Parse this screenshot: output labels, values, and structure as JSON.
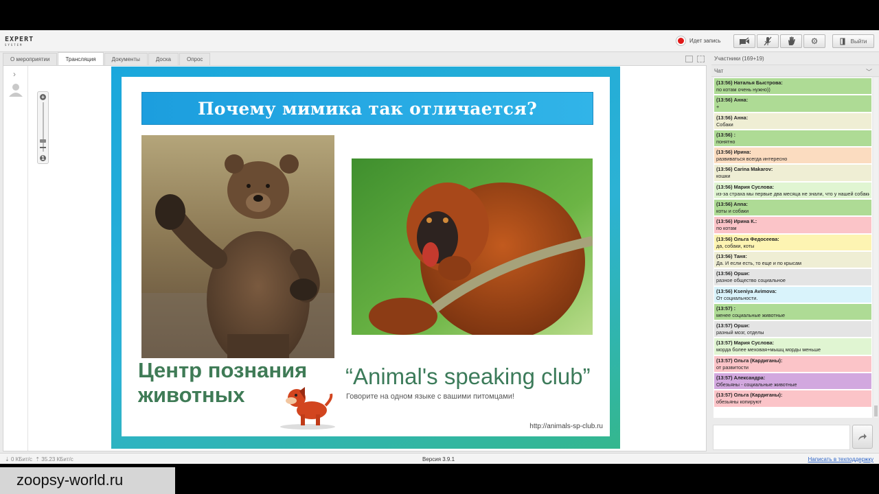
{
  "app": {
    "logo": "EXPERT",
    "logo_sub": "SYSTEM"
  },
  "recording": {
    "label": "Идет запись",
    "color": "#e01818"
  },
  "toolbar": {
    "exit_label": "Выйти"
  },
  "tabs": [
    "О мероприятии",
    "Трансляция",
    "Документы",
    "Доска",
    "Опрос"
  ],
  "active_tab": 1,
  "slide": {
    "title": "Почему мимика так отличается?",
    "center_name_line1": "Центр познания",
    "center_name_line2": "животных",
    "club_name": "“Animal's speaking club”",
    "club_subtitle": "Говорите на одном языке с вашими питомцами!",
    "club_url": "http://animals-sp-club.ru"
  },
  "participants": {
    "label": "Участники (169+19)"
  },
  "chat": {
    "header": "Чат",
    "messages": [
      {
        "time": "(13:56)",
        "author": "Наталья Быстрова:",
        "text": "по котам очень нужно))",
        "color": "#aedb95"
      },
      {
        "time": "(13:56)",
        "author": "Анна:",
        "text": "+",
        "color": "#aedb95"
      },
      {
        "time": "(13:56)",
        "author": "Анна:",
        "text": "Собаки",
        "color": "#efeed4"
      },
      {
        "time": "(13:56)",
        "author": ":",
        "text": "понятно",
        "color": "#aedb95"
      },
      {
        "time": "(13:56)",
        "author": "Ирина:",
        "text": "развиваться всегда интересно",
        "color": "#fbdcc0"
      },
      {
        "time": "(13:56)",
        "author": "Carina Makarov:",
        "text": "кошки",
        "color": "#efeed4"
      },
      {
        "time": "(13:56)",
        "author": "Мария Суслова:",
        "text": "из-за страха мы первые два месяца не знали, что у нашей собаки есть хвост",
        "color": "#e0f5d2"
      },
      {
        "time": "(13:56)",
        "author": "Anna:",
        "text": "коты и собаки",
        "color": "#aedb95"
      },
      {
        "time": "(13:56)",
        "author": "Ирина К.:",
        "text": "по котам",
        "color": "#fbc4c8"
      },
      {
        "time": "(13:56)",
        "author": "Ольга Федосеева:",
        "text": "да, собаки, коты",
        "color": "#fdf4b2"
      },
      {
        "time": "(13:56)",
        "author": "Таня:",
        "text": "Да. И если есть, то еще и по крысам",
        "color": "#efeed4"
      },
      {
        "time": "(13:56)",
        "author": "Орши:",
        "text": "разное общество социальное",
        "color": "#e4e4e4"
      },
      {
        "time": "(13:56)",
        "author": "Kseniya Avimova:",
        "text": "От социальности.",
        "color": "#d9f3fb"
      },
      {
        "time": "(13:57)",
        "author": ":",
        "text": "менее социальные животные",
        "color": "#aedb95"
      },
      {
        "time": "(13:57)",
        "author": "Орши:",
        "text": "разный мозг, отделы",
        "color": "#e4e4e4"
      },
      {
        "time": "(13:57)",
        "author": "Мария Суслова:",
        "text": "морда более меховая+мышц морды меньше",
        "color": "#e0f5d2"
      },
      {
        "time": "(13:57)",
        "author": "Ольга (Кардиганы):",
        "text": "от развитости",
        "color": "#fbc4c8"
      },
      {
        "time": "(13:57)",
        "author": "Александра:",
        "text": "Обезьяны - социальные животные",
        "color": "#d2a8df"
      },
      {
        "time": "(13:57)",
        "author": "Ольга (Кардиганы):",
        "text": "обезьяны копируют",
        "color": "#fbc4c8"
      }
    ]
  },
  "status": {
    "speed_in": "0 КБит/с",
    "speed_out": "35.23 КБит/с",
    "version": "Версия 3.9.1",
    "help_link": "Написать в техподдержку"
  },
  "watermark": "zoopsy-world.ru"
}
